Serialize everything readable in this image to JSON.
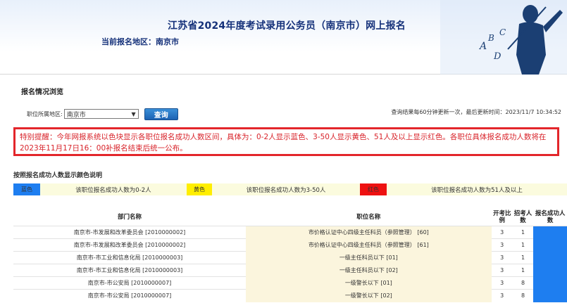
{
  "header": {
    "title": "江苏省2024年度考试录用公务员（南京市）网上报名",
    "current_region": "当前报名地区：南京市"
  },
  "section_title": "报名情况浏览",
  "filter": {
    "label": "职位所属地区:",
    "selected": "南京市",
    "button": "查询"
  },
  "update_info": "查询结果每60分钟更新一次，最后更新时间：2023/11/7 10:34:52",
  "notice": "特别提醒：今年网报系统以色块显示各职位报名成功人数区间，具体为：0-2人显示蓝色、3-50人显示黄色、51人及以上显示红色。各职位具体报名成功人数将在2023年11月17日16：00补报名结束后统一公布。",
  "legend": {
    "title": "按照报名成功人数显示颜色说明",
    "items": [
      {
        "swatch_label": "蓝色",
        "text": "该职位报名成功人数为0-2人",
        "color": "#1e7ef0"
      },
      {
        "swatch_label": "黄色",
        "text": "该职位报名成功人数为3-50人",
        "color": "#ffee00"
      },
      {
        "swatch_label": "红色",
        "text": "该职位报名成功人数为51人及以上",
        "color": "#ee1111"
      }
    ]
  },
  "table": {
    "headers": {
      "dept": "部门名称",
      "position": "职位名称",
      "ratio": "开考比例",
      "quota": "招考人数",
      "success": "报名成功人数"
    },
    "rows": [
      {
        "dept": "南京市-市发展和改革委员会 [2010000002]",
        "position": "市价格认证中心四级主任科员（参照管理） [60]",
        "ratio": "3",
        "quota": "1"
      },
      {
        "dept": "南京市-市发展和改革委员会 [2010000002]",
        "position": "市价格认证中心四级主任科员（参照管理） [61]",
        "ratio": "3",
        "quota": "1"
      },
      {
        "dept": "南京市-市工业和信息化局 [2010000003]",
        "position": "一级主任科员以下 [01]",
        "ratio": "3",
        "quota": "1"
      },
      {
        "dept": "南京市-市工业和信息化局 [2010000003]",
        "position": "一级主任科员以下 [02]",
        "ratio": "3",
        "quota": "1"
      },
      {
        "dept": "南京市-市公安局 [2010000007]",
        "position": "一级警长以下 [01]",
        "ratio": "3",
        "quota": "8"
      },
      {
        "dept": "南京市-市公安局 [2010000007]",
        "position": "一级警长以下 [02]",
        "ratio": "3",
        "quota": "8"
      }
    ]
  }
}
